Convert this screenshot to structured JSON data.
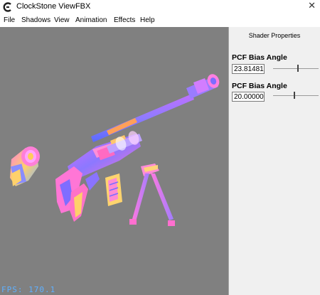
{
  "window": {
    "title": "ClockStone ViewFBX",
    "close_glyph": "✕",
    "icon": "clockstone-logo-icon"
  },
  "menu": {
    "items": [
      "File",
      "Shadows",
      "View",
      "Animation",
      "Effects",
      "Help"
    ]
  },
  "viewport": {
    "fps_text": "FPS: 170.1",
    "fps_color": "#5fb0ff",
    "background_color": "#808080",
    "scene": "normal-map rendered sniper rifle model with scope and bipod"
  },
  "panel": {
    "title": "Shader Properties",
    "params": [
      {
        "label": "PCF Bias Angle",
        "value": "23.81481",
        "slider_level": 0.55
      },
      {
        "label": "PCF Bias Angle",
        "value": "20.00000",
        "slider_level": 0.46
      }
    ]
  }
}
